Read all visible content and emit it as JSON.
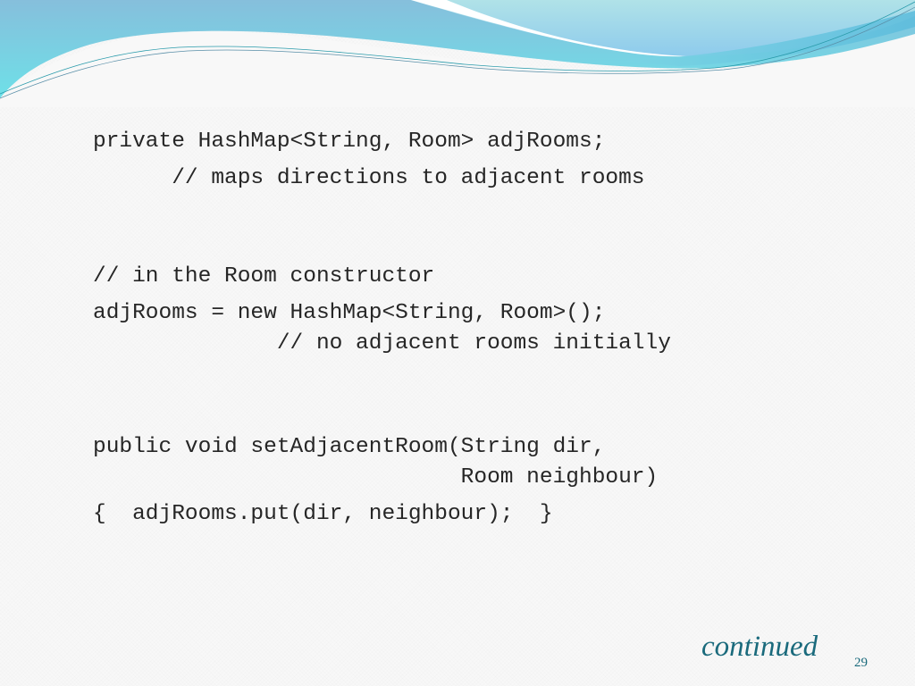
{
  "slide": {
    "code_blocks": [
      {
        "lines": [
          "private HashMap<String, Room> adjRooms;",
          "      // maps directions to adjacent rooms"
        ]
      },
      {
        "lines": [
          "// in the Room constructor",
          "adjRooms = new HashMap<String, Room>();",
          "              // no adjacent rooms initially"
        ]
      },
      {
        "lines": [
          "public void setAdjacentRoom(String dir,",
          "                            Room neighbour)",
          "{  adjRooms.put(dir, neighbour);  }"
        ]
      }
    ],
    "continued_label": "continued",
    "page_number": "29",
    "colors": {
      "accent": "#1a6a7c",
      "text": "#262626",
      "wave_light": "#a8dde6",
      "wave_mid": "#7fc6de",
      "wave_cyan": "#6fdde6"
    }
  }
}
